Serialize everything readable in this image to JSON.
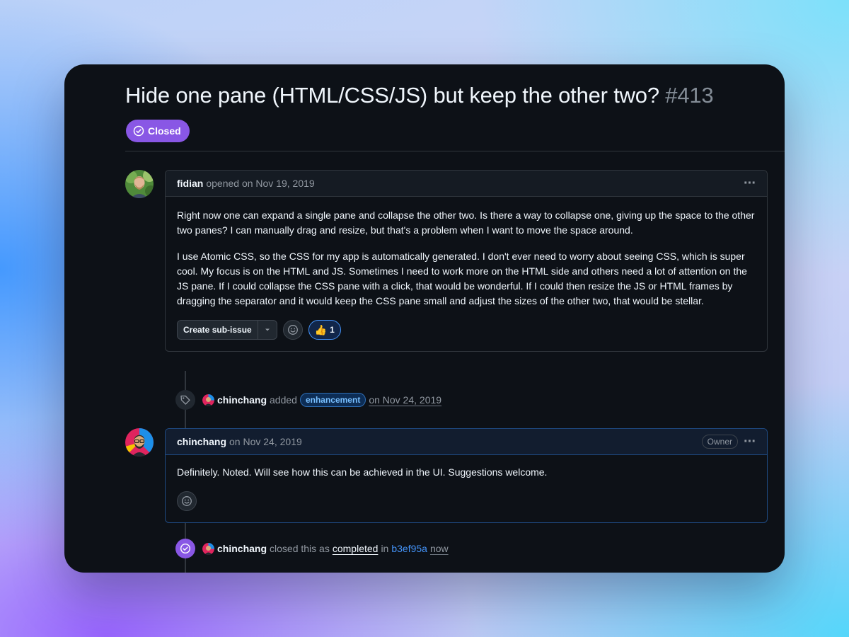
{
  "issue": {
    "title": "Hide one pane (HTML/CSS/JS) but keep the other two?",
    "number": "#413",
    "state": "Closed"
  },
  "comments": [
    {
      "author": "fidian",
      "meta": "opened on Nov 19, 2019",
      "paragraphs": [
        "Right now one can expand a single pane and collapse the other two. Is there a way to collapse one, giving up the space to the other two panes? I can manually drag and resize, but that's a problem when I want to move the space around.",
        "I use Atomic CSS, so the CSS for my app is automatically generated. I don't ever need to worry about seeing CSS, which is super cool. My focus is on the HTML and JS. Sometimes I need to work more on the HTML side and others need a lot of attention on the JS pane. If I could collapse the CSS pane with a click, that would be wonderful. If I could then resize the JS or HTML frames by dragging the separator and it would keep the CSS pane small and adjust the sizes of the other two, that would be stellar."
      ],
      "sub_issue_label": "Create sub-issue",
      "reaction_emoji": "👍",
      "reaction_count": "1"
    },
    {
      "author": "chinchang",
      "meta": "on Nov 24, 2019",
      "owner_badge": "Owner",
      "paragraphs": [
        "Definitely. Noted. Will see how this can be achieved in the UI. Suggestions welcome."
      ]
    }
  ],
  "events": [
    {
      "actor": "chinchang",
      "action": "added",
      "label": "enhancement",
      "time": "on Nov 24, 2019"
    },
    {
      "actor": "chinchang",
      "action": "closed this as",
      "reason": "completed",
      "preposition": "in",
      "commit": "b3ef95a",
      "time": "now"
    }
  ],
  "colors": {
    "background": "#0d1117",
    "closed_purple": "#8957e5",
    "link_blue": "#4493f8",
    "border": "#30363d"
  },
  "icons": {
    "state": "check-circle-icon",
    "label_event": "tag-icon",
    "closed_event": "check-circle-icon",
    "menu": "kebab-horizontal-icon",
    "reaction_picker": "smiley-icon",
    "dropdown": "triangle-down-icon"
  }
}
